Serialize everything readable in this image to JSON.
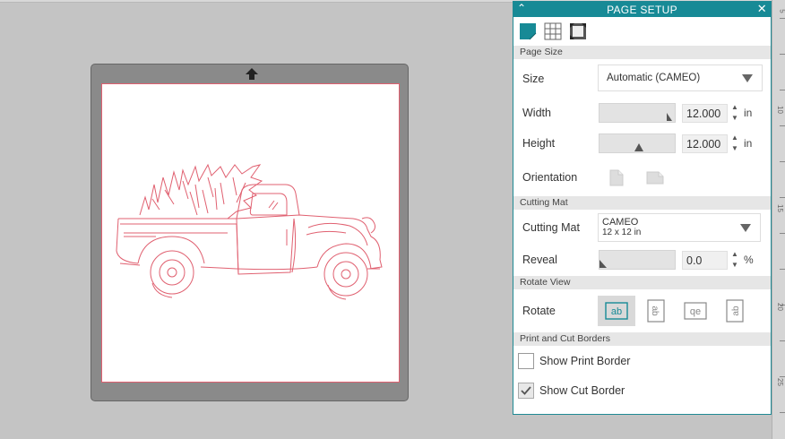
{
  "panel": {
    "title": "PAGE SETUP",
    "collapse_glyph": "⌃",
    "close_glyph": "✕",
    "tabs": [
      {
        "name": "page-setup-tab",
        "icon": "page-icon",
        "active": true
      },
      {
        "name": "grid-tab",
        "icon": "grid-icon",
        "active": false
      },
      {
        "name": "registration-tab",
        "icon": "registration-marks-icon",
        "active": false
      }
    ]
  },
  "page_size": {
    "section": "Page Size",
    "size_label": "Size",
    "size_value": "Automatic (CAMEO)",
    "width_label": "Width",
    "width_value": "12.000",
    "width_unit": "in",
    "height_label": "Height",
    "height_value": "12.000",
    "height_unit": "in",
    "orientation_label": "Orientation"
  },
  "cutting_mat": {
    "section": "Cutting Mat",
    "label": "Cutting Mat",
    "value_line1": "CAMEO",
    "value_line2": "12 x 12 in",
    "reveal_label": "Reveal",
    "reveal_value": "0.0",
    "reveal_unit": "%"
  },
  "rotate_view": {
    "section": "Rotate View",
    "label": "Rotate",
    "options": [
      "ab",
      "ab",
      "qe",
      "ab"
    ],
    "active_index": 0
  },
  "borders": {
    "section": "Print and Cut Borders",
    "print_label": "Show Print Border",
    "print_checked": false,
    "cut_label": "Show Cut Border",
    "cut_checked": true
  },
  "ruler": [
    "5",
    "10",
    "15",
    "20",
    "25"
  ],
  "colors": {
    "accent": "#178a96",
    "cut_line": "#e06070",
    "mat": "#8a8a8a"
  }
}
